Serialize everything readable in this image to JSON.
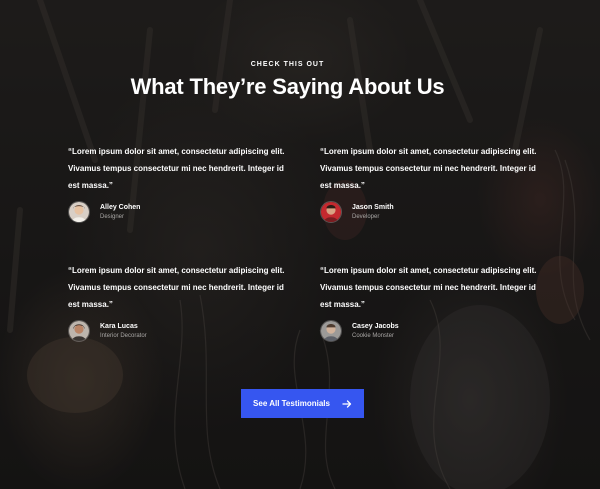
{
  "section": {
    "eyebrow": "CHECK THIS OUT",
    "heading": "What They’re Saying About Us"
  },
  "testimonials": [
    {
      "quote_lines": [
        "“Lorem ipsum dolor sit amet, consectetur adipiscing elit.",
        "Vivamus tempus consectetur mi nec hendrerit. Integer id",
        "est massa.”"
      ],
      "name": "Alley Cohen",
      "role": "Designer",
      "avatar_icon": "avatar-alley-cohen"
    },
    {
      "quote_lines": [
        "“Lorem ipsum dolor sit amet, consectetur adipiscing elit.",
        "Vivamus tempus consectetur mi nec hendrerit. Integer id",
        "est massa.”"
      ],
      "name": "Jason Smith",
      "role": "Developer",
      "avatar_icon": "avatar-jason-smith"
    },
    {
      "quote_lines": [
        "“Lorem ipsum dolor sit amet, consectetur adipiscing elit.",
        "Vivamus tempus consectetur mi nec hendrerit. Integer id",
        "est massa.”"
      ],
      "name": "Kara Lucas",
      "role": "Interior Decorator",
      "avatar_icon": "avatar-kara-lucas"
    },
    {
      "quote_lines": [
        "“Lorem ipsum dolor sit amet, consectetur adipiscing elit.",
        "Vivamus tempus consectetur mi nec hendrerit. Integer id",
        "est massa.”"
      ],
      "name": "Casey Jacobs",
      "role": "Cookie Monster",
      "avatar_icon": "avatar-casey-jacobs"
    }
  ],
  "cta": {
    "label": "See All Testimonials",
    "icon": "arrow-right-icon"
  },
  "colors": {
    "accent": "#3656f0",
    "text": "#ffffff",
    "muted": "#a9a7a5",
    "background": "#1c1a19"
  }
}
